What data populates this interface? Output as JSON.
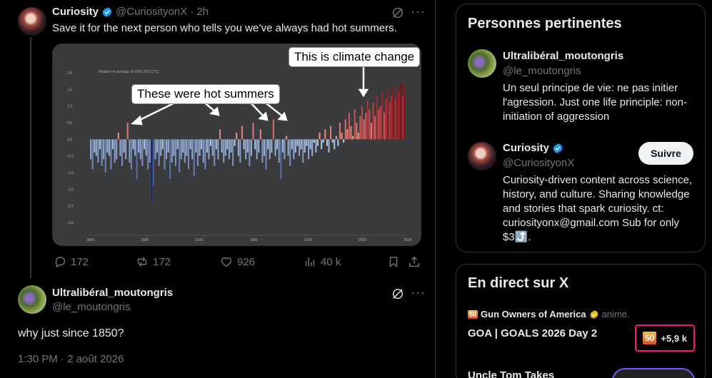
{
  "tweet1": {
    "name": "Curiosity",
    "handle": "@CuriosityonX",
    "time": "· 2h",
    "text": "Save it for the next person who tells you we’ve always had hot summers.",
    "callout_left": "These were hot summers",
    "callout_right": "This is climate change",
    "actions": {
      "replies": "172",
      "reposts": "172",
      "likes": "926",
      "views": "40 k"
    }
  },
  "tweet2": {
    "name": "Ultralibéral_moutongris",
    "handle": "@le_moutongris",
    "text": "why just since 1850?",
    "timestamp": "1:30 PM · 2 août 2026"
  },
  "related": {
    "title": "Personnes pertinentes",
    "people": [
      {
        "name": "Ultralibéral_moutongris",
        "handle": "@le_moutongris",
        "bio": "Un seul principe de vie: ne pas initier l'agression. Just one life principle: non-initiation of aggression"
      },
      {
        "name": "Curiosity",
        "handle": "@CuriosityonX",
        "bio": "Curiosity-driven content across science, history, and culture. Sharing knowledge and stories that spark curiosity. ct: curiosityonx@gmail.com Sub for only $3⤴️.",
        "follow_label": "Suivre"
      }
    ]
  },
  "live": {
    "title": "En direct sur X",
    "host_name": "Gun Owners of America",
    "host_action": "anime.",
    "badge_text": "50",
    "event_title": "GOA | GOALS 2026 Day 2",
    "listeners": "+5,9 k",
    "next_title": "Uncle Tom Takes"
  },
  "colors": {
    "background": "#000000",
    "verified_blue": "#1d9bf0",
    "accent_pink": "#f91880",
    "text_secondary": "#71767b"
  },
  "chart_data": {
    "type": "bar",
    "title": "",
    "subtitle": "Relative to average of 1961-2010 [°C]",
    "x": [
      1850,
      1851,
      1852,
      1853,
      1854,
      1855,
      1856,
      1857,
      1858,
      1859,
      1860,
      1861,
      1862,
      1863,
      1864,
      1865,
      1866,
      1867,
      1868,
      1869,
      1870,
      1871,
      1872,
      1873,
      1874,
      1875,
      1876,
      1877,
      1878,
      1879,
      1880,
      1881,
      1882,
      1883,
      1884,
      1885,
      1886,
      1887,
      1888,
      1889,
      1890,
      1891,
      1892,
      1893,
      1894,
      1895,
      1896,
      1897,
      1898,
      1899,
      1900,
      1901,
      1902,
      1903,
      1904,
      1905,
      1906,
      1907,
      1908,
      1909,
      1910,
      1911,
      1912,
      1913,
      1914,
      1915,
      1916,
      1917,
      1918,
      1919,
      1920,
      1921,
      1922,
      1923,
      1924,
      1925,
      1926,
      1927,
      1928,
      1929,
      1930,
      1931,
      1932,
      1933,
      1934,
      1935,
      1936,
      1937,
      1938,
      1939,
      1940,
      1941,
      1942,
      1943,
      1944,
      1945,
      1946,
      1947,
      1948,
      1949,
      1950,
      1951,
      1952,
      1953,
      1954,
      1955,
      1956,
      1957,
      1958,
      1959,
      1960,
      1961,
      1962,
      1963,
      1964,
      1965,
      1966,
      1967,
      1968,
      1969,
      1970,
      1971,
      1972,
      1973,
      1974,
      1975,
      1976,
      1977,
      1978,
      1979,
      1980,
      1981,
      1982,
      1983,
      1984,
      1985,
      1986,
      1987,
      1988,
      1989,
      1990,
      1991,
      1992,
      1993,
      1994,
      1995,
      1996,
      1997,
      1998,
      1999,
      2000,
      2001,
      2002,
      2003,
      2004,
      2005,
      2006,
      2007,
      2008,
      2009,
      2010,
      2011,
      2012,
      2013,
      2014,
      2015,
      2016,
      2017,
      2018,
      2019,
      2020,
      2021,
      2022,
      2023,
      2024
    ],
    "values": [
      -0.6,
      -0.9,
      -0.4,
      -0.5,
      -0.7,
      -0.3,
      -0.8,
      -0.6,
      -1.0,
      -0.4,
      -0.5,
      -0.9,
      -0.3,
      -0.7,
      -0.6,
      0.2,
      -0.5,
      -0.8,
      -0.4,
      -0.6,
      0.5,
      -0.7,
      -0.9,
      -0.3,
      -0.5,
      -1.2,
      -0.4,
      -0.6,
      -0.8,
      -0.3,
      -0.5,
      -0.9,
      -0.7,
      -1.9,
      -1.4,
      -0.6,
      -0.4,
      -0.8,
      -0.5,
      -0.3,
      -0.9,
      -0.6,
      -0.4,
      -1.2,
      -0.7,
      -0.5,
      -0.8,
      -0.3,
      -1.0,
      -0.6,
      -0.4,
      -0.7,
      -0.5,
      -0.9,
      -0.3,
      -0.6,
      -1.1,
      -0.4,
      -0.8,
      -0.5,
      -0.3,
      -0.7,
      -0.9,
      -0.4,
      -0.6,
      -0.2,
      -0.5,
      -0.8,
      -0.3,
      -0.6,
      0.3,
      -0.4,
      -0.7,
      -0.5,
      -0.3,
      -0.6,
      -0.4,
      -0.8,
      -0.2,
      0.2,
      -0.5,
      -0.7,
      0.4,
      -0.3,
      -0.6,
      -0.4,
      -0.8,
      -0.5,
      0.5,
      -0.3,
      -0.6,
      -0.4,
      0.3,
      -0.7,
      -0.5,
      -0.9,
      -0.3,
      -0.6,
      -0.4,
      0.6,
      -0.5,
      -0.3,
      -0.7,
      -1.2,
      -0.4,
      -0.6,
      0.1,
      -0.5,
      -0.8,
      -0.3,
      -0.6,
      -0.4,
      -0.2,
      -0.5,
      -0.3,
      -0.7,
      -0.4,
      -0.2,
      -0.6,
      -0.3,
      -0.5,
      -0.1,
      -0.4,
      -0.2,
      0.2,
      -0.3,
      -0.1,
      0.3,
      -0.2,
      -0.4,
      0.4,
      -0.1,
      -0.3,
      0.1,
      -0.2,
      0.5,
      0.2,
      -0.1,
      0.6,
      0.3,
      0.8,
      0.4,
      0.1,
      0.9,
      0.5,
      0.2,
      0.7,
      1.0,
      0.6,
      0.8,
      1.2,
      0.9,
      0.5,
      1.1,
      0.7,
      1.3,
      0.9,
      1.0,
      1.4,
      0.8,
      1.2,
      1.5,
      1.1,
      1.3,
      1.6,
      1.2,
      1.5,
      1.4,
      1.7,
      1.3,
      1.6
    ],
    "xticks": [
      "1850",
      "1880",
      "1910",
      "1940",
      "1970",
      "2000",
      "2025"
    ],
    "yticks": [
      "2.0",
      "1.5",
      "1.0",
      "0.5",
      "0.0",
      "-0.5",
      "-1.0",
      "-1.5",
      "-2.0",
      "-2.5"
    ],
    "ylim": [
      -2.5,
      2.0
    ],
    "xlabel": "",
    "ylabel": "",
    "grid": false
  }
}
